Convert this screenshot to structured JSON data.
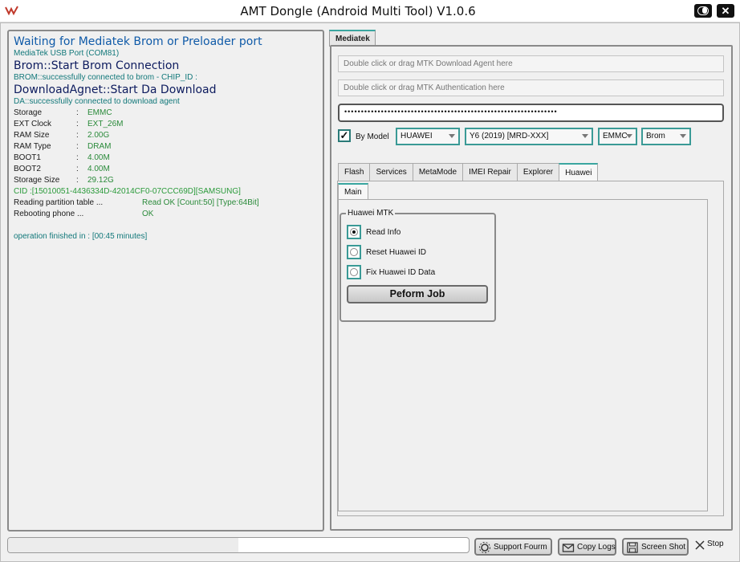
{
  "window": {
    "title": "AMT Dongle (Android Multi Tool) V1.0.6",
    "close_label": "✕"
  },
  "log": {
    "header": "Waiting for Mediatek Brom or Preloader port",
    "usb_port": "MediaTek USB Port (COM81)",
    "brom_start": "Brom::Start Brom Connection",
    "brom_ok": "BROM::successfully connected to brom - CHIP_ID :",
    "da_start": "DownloadAgnet::Start Da Download",
    "da_ok": "DA::successfully connected to download agent",
    "info": [
      {
        "key": "Storage",
        "value": "EMMC"
      },
      {
        "key": "EXT Clock",
        "value": "EXT_26M"
      },
      {
        "key": "RAM Size",
        "value": "2.00G"
      },
      {
        "key": "RAM Type",
        "value": "DRAM"
      },
      {
        "key": "BOOT1",
        "value": "4.00M"
      },
      {
        "key": "BOOT2",
        "value": "4.00M"
      },
      {
        "key": "Storage Size",
        "value": "29.12G"
      }
    ],
    "sep": ":",
    "cid": "CID :[15010051-4436334D-42014CF0-07CCC69D][SAMSUNG]",
    "partition_label": "Reading partition table ...",
    "partition_value": "Read OK [Count:50] [Type:64Bit]",
    "reboot_label": "Rebooting phone ...",
    "reboot_value": "OK",
    "finished": "operation finished in : [00:45 minutes]"
  },
  "main_tab": "Mediatek",
  "fields": {
    "download_agent_placeholder": "Double click or drag MTK Download Agent here",
    "auth_placeholder": "Double click or drag MTK Authentication here",
    "password_mask": "••••••••••••••••••••••••••••••••••••••••••••••••••••••••••••••••"
  },
  "by_model": {
    "checked": true,
    "label": "By Model",
    "check_glyph": "✓"
  },
  "selects": {
    "brand": "HUAWEI",
    "model": "Y6 (2019) [MRD-XXX]",
    "storage": "EMMC",
    "mode": "Brom"
  },
  "subtabs": [
    "Flash",
    "Services",
    "MetaMode",
    "IMEI Repair",
    "Explorer",
    "Huawei"
  ],
  "active_subtab": "Huawei",
  "inner_tab": "Main",
  "huawei_group": {
    "title": "Huawei MTK",
    "options": [
      {
        "label": "Read Info",
        "selected": true
      },
      {
        "label": "Reset Huawei ID",
        "selected": false
      },
      {
        "label": "Fix Huawei ID Data",
        "selected": false
      }
    ],
    "perform_label": "Peform Job"
  },
  "statusbar": {
    "progress": 0.5,
    "support_label": "Support Fourm",
    "copy_logs_label": "Copy Logs",
    "screenshot_label": "Screen Shot",
    "stop_label": "Stop"
  },
  "colors": {
    "accent": "#3aa6a0",
    "log_blue": "#0f5aa8",
    "log_navy": "#0d1b5e",
    "log_teal": "#12787a",
    "log_green": "#2a9a3a"
  }
}
